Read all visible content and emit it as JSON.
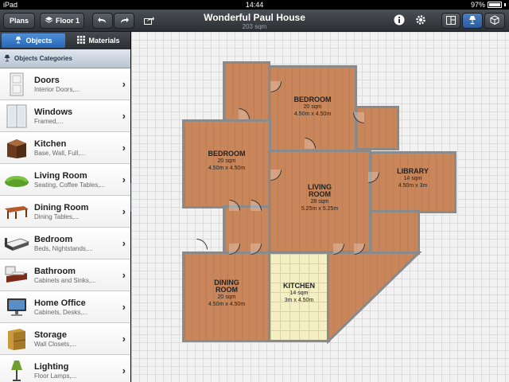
{
  "status": {
    "device": "iPad",
    "time": "14:44",
    "battery": "97%"
  },
  "toolbar": {
    "plans_label": "Plans",
    "floor_label": "Floor 1",
    "title": "Wonderful Paul House",
    "subtitle": "203 sqm"
  },
  "sidebar": {
    "tabs": [
      {
        "label": "Objects"
      },
      {
        "label": "Materials"
      }
    ],
    "header": "Objects Categories",
    "items": [
      {
        "name": "Doors",
        "sub": "Interior Doors,..."
      },
      {
        "name": "Windows",
        "sub": "Framed,..."
      },
      {
        "name": "Kitchen",
        "sub": "Base, Wall, Full,..."
      },
      {
        "name": "Living Room",
        "sub": "Seating, Coffee Tables,..."
      },
      {
        "name": "Dining Room",
        "sub": "Dining Tables,..."
      },
      {
        "name": "Bedroom",
        "sub": "Beds, Nightstands,..."
      },
      {
        "name": "Bathroom",
        "sub": "Cabinets and Sinks,..."
      },
      {
        "name": "Home Office",
        "sub": "Cabinets, Desks,..."
      },
      {
        "name": "Storage",
        "sub": "Wall Closets,..."
      },
      {
        "name": "Lighting",
        "sub": "Floor Lamps,..."
      }
    ]
  },
  "rooms": [
    {
      "name": "BEDROOM",
      "area": "20 sqm",
      "dims": "4.50m x 4.50m"
    },
    {
      "name": "BEDROOM",
      "area": "20 sqm",
      "dims": "4.50m x 4.50m"
    },
    {
      "name": "LIVING",
      "name2": "ROOM",
      "area": "28 sqm",
      "dims": "5.25m x 5.25m"
    },
    {
      "name": "LIBRARY",
      "area": "14 sqm",
      "dims": "4.50m x 3m"
    },
    {
      "name": "DINING",
      "name2": "ROOM",
      "area": "20 sqm",
      "dims": "4.50m x 4.50m"
    },
    {
      "name": "KITCHEN",
      "area": "14 sqm",
      "dims": "3m x 4.50m"
    }
  ],
  "colors": {
    "floor_wood": "#c8865a",
    "floor_tile": "#f4efc2",
    "wall": "#8a8a8a",
    "accent_blue": "#2767b6"
  }
}
